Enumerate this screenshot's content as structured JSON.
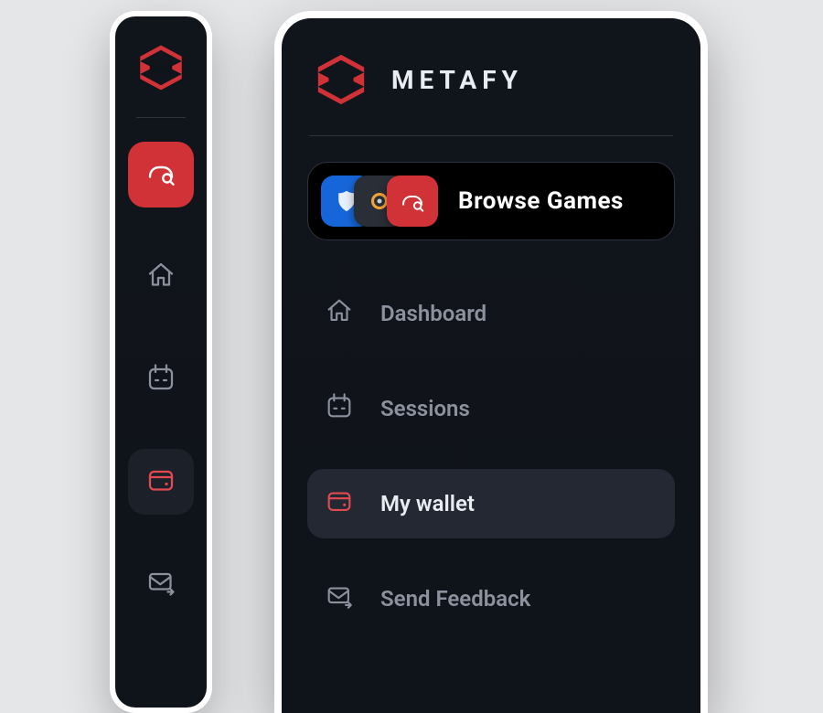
{
  "brand": {
    "name": "METAFY"
  },
  "colors": {
    "accent": "#d03238"
  },
  "browse": {
    "label": "Browse Games"
  },
  "nav": {
    "items": [
      {
        "id": "dashboard",
        "label": "Dashboard",
        "icon": "home-icon",
        "active": false
      },
      {
        "id": "sessions",
        "label": "Sessions",
        "icon": "calendar-icon",
        "active": false
      },
      {
        "id": "wallet",
        "label": "My wallet",
        "icon": "wallet-icon",
        "active": true
      },
      {
        "id": "feedback",
        "label": "Send Feedback",
        "icon": "mail-icon",
        "active": false
      }
    ]
  },
  "rail": {
    "items": [
      {
        "id": "browse",
        "icon": "controller-search-icon",
        "style": "accent"
      },
      {
        "id": "dashboard",
        "icon": "home-icon",
        "style": "muted"
      },
      {
        "id": "sessions",
        "icon": "calendar-icon",
        "style": "muted"
      },
      {
        "id": "wallet",
        "icon": "wallet-icon",
        "style": "active"
      },
      {
        "id": "feedback",
        "icon": "mail-icon",
        "style": "muted"
      }
    ]
  }
}
